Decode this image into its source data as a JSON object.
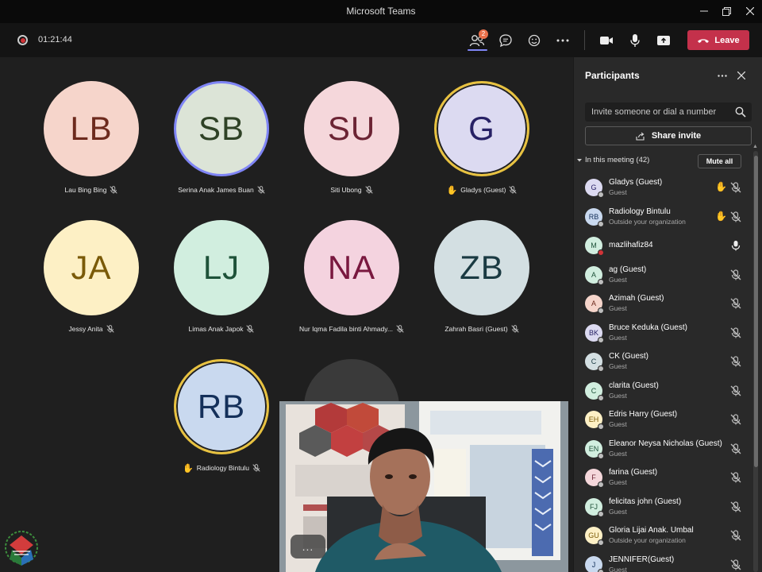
{
  "window": {
    "title": "Microsoft Teams"
  },
  "toolbar": {
    "timer": "01:21:44",
    "people_badge": "2",
    "leave_label": "Leave"
  },
  "tiles": [
    {
      "initials": "LB",
      "name": "Lau Bing Bing",
      "bg": "#f6d5cb",
      "fg": "#6d2a1d",
      "raised_hand": false
    },
    {
      "initials": "SB",
      "name": "Serina Anak James Buan",
      "bg": "#dce4d7",
      "fg": "#2f4226",
      "raised_hand": false
    },
    {
      "initials": "SU",
      "name": "Siti Ubong",
      "bg": "#f5d7db",
      "fg": "#6c2434",
      "raised_hand": false
    },
    {
      "initials": "G",
      "name": "Gladys (Guest)",
      "bg": "#dcdaf1",
      "fg": "#272165",
      "raised_hand": true
    },
    {
      "initials": "JA",
      "name": "Jessy Anita",
      "bg": "#fdf0c5",
      "fg": "#7a5a08",
      "raised_hand": false
    },
    {
      "initials": "LJ",
      "name": "Limas Anak Japok",
      "bg": "#d1eedf",
      "fg": "#1e5239",
      "raised_hand": false
    },
    {
      "initials": "NA",
      "name": "Nur Iqma Fadila binti Ahmady...",
      "bg": "#f4d3df",
      "fg": "#79183f",
      "raised_hand": false
    },
    {
      "initials": "ZB",
      "name": "Zahrah Basri (Guest)",
      "bg": "#d3dfe2",
      "fg": "#1a3a42",
      "raised_hand": false
    },
    {
      "initials": "RB",
      "name": "Radiology Bintulu",
      "bg": "#c9d9ef",
      "fg": "#14305a",
      "raised_hand": true
    }
  ],
  "video_overlay": {
    "more_label": "..."
  },
  "sidebar": {
    "title": "Participants",
    "invite_placeholder": "Invite someone or dial a number",
    "share_invite_label": "Share invite",
    "in_meeting_label": "In this meeting (42)",
    "mute_all_label": "Mute all",
    "participants": [
      {
        "initials": "G",
        "name": "Gladys (Guest)",
        "sub": "Guest",
        "hand": true,
        "mic": "muted",
        "bg": "#dcdaf1",
        "fg": "#272165",
        "presence": "offline"
      },
      {
        "initials": "RB",
        "name": "Radiology Bintulu",
        "sub": "Outside your organization",
        "hand": true,
        "mic": "muted",
        "bg": "#c9d9ef",
        "fg": "#14305a",
        "presence": "offline"
      },
      {
        "initials": "M",
        "name": "mazlihafiz84",
        "sub": "",
        "hand": false,
        "mic": "on",
        "bg": "#d1eedf",
        "fg": "#1e5239",
        "presence": "busy"
      },
      {
        "initials": "A",
        "name": "ag (Guest)",
        "sub": "Guest",
        "hand": false,
        "mic": "muted",
        "bg": "#d1eedf",
        "fg": "#1e5239",
        "presence": "offline"
      },
      {
        "initials": "A",
        "name": "Azimah (Guest)",
        "sub": "Guest",
        "hand": false,
        "mic": "muted",
        "bg": "#f6d5cb",
        "fg": "#6d2a1d",
        "presence": "offline"
      },
      {
        "initials": "BK",
        "name": "Bruce Keduka (Guest)",
        "sub": "Guest",
        "hand": false,
        "mic": "muted",
        "bg": "#dcdaf1",
        "fg": "#272165",
        "presence": "offline"
      },
      {
        "initials": "C",
        "name": "CK (Guest)",
        "sub": "Guest",
        "hand": false,
        "mic": "muted",
        "bg": "#d3dfe2",
        "fg": "#1a3a42",
        "presence": "offline"
      },
      {
        "initials": "C",
        "name": "clarita (Guest)",
        "sub": "Guest",
        "hand": false,
        "mic": "muted",
        "bg": "#d1eedf",
        "fg": "#1e5239",
        "presence": "offline"
      },
      {
        "initials": "EH",
        "name": "Edris Harry (Guest)",
        "sub": "Guest",
        "hand": false,
        "mic": "muted",
        "bg": "#fdf0c5",
        "fg": "#7a5a08",
        "presence": "offline"
      },
      {
        "initials": "EN",
        "name": "Eleanor Neysa Nicholas (Guest)",
        "sub": "Guest",
        "hand": false,
        "mic": "muted",
        "bg": "#d1eedf",
        "fg": "#1e5239",
        "presence": "offline"
      },
      {
        "initials": "F",
        "name": "farina (Guest)",
        "sub": "Guest",
        "hand": false,
        "mic": "muted",
        "bg": "#f5d7db",
        "fg": "#6c2434",
        "presence": "offline"
      },
      {
        "initials": "FJ",
        "name": "felicitas john (Guest)",
        "sub": "Guest",
        "hand": false,
        "mic": "muted",
        "bg": "#d1eedf",
        "fg": "#1e5239",
        "presence": "offline"
      },
      {
        "initials": "GU",
        "name": "Gloria Lijai Anak. Umbal",
        "sub": "Outside your organization",
        "hand": false,
        "mic": "muted",
        "bg": "#fdf0c5",
        "fg": "#7a5a08",
        "presence": "offline"
      },
      {
        "initials": "J",
        "name": "JENNIFER(Guest)",
        "sub": "Guest",
        "hand": false,
        "mic": "muted",
        "bg": "#c9d9ef",
        "fg": "#14305a",
        "presence": "offline"
      }
    ]
  },
  "colors": {
    "accent": "#7f85f5",
    "leave": "#c4314b",
    "hand": "#e8a317",
    "ring_yellow": "#e8c240"
  }
}
